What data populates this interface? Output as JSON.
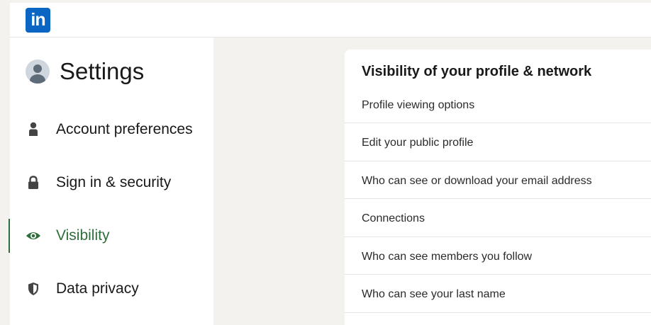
{
  "header": {
    "logo_text": "in",
    "brand_color": "#0a66c2"
  },
  "sidebar": {
    "title": "Settings",
    "items": [
      {
        "label": "Account preferences",
        "icon": "person-icon",
        "active": false
      },
      {
        "label": "Sign in & security",
        "icon": "lock-icon",
        "active": false
      },
      {
        "label": "Visibility",
        "icon": "eye-icon",
        "active": true
      },
      {
        "label": "Data privacy",
        "icon": "shield-icon",
        "active": false
      }
    ],
    "active_color": "#2f6e3b"
  },
  "main": {
    "section_title": "Visibility of your profile & network",
    "rows": [
      {
        "label": "Profile viewing options"
      },
      {
        "label": "Edit your public profile"
      },
      {
        "label": "Who can see or download your email address"
      },
      {
        "label": "Connections"
      },
      {
        "label": "Who can see members you follow"
      },
      {
        "label": "Who can see your last name"
      }
    ]
  }
}
